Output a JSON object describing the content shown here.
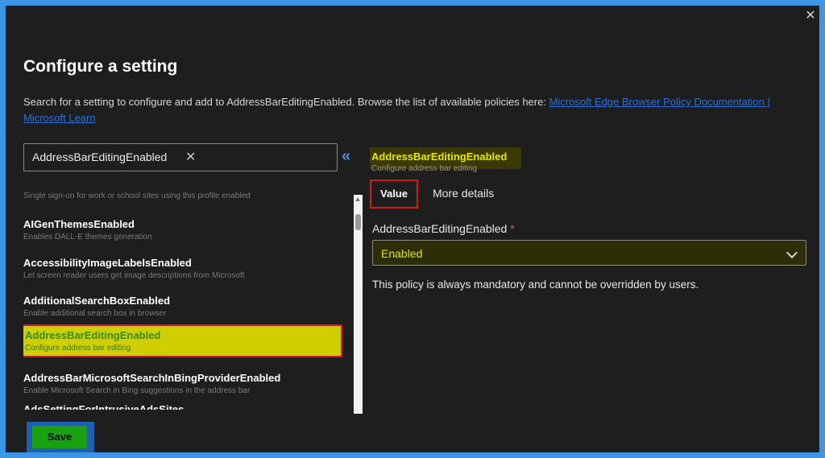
{
  "dialog": {
    "title": "Configure a setting",
    "description_text": "Search for a setting to configure and add to AddressBarEditingEnabled. Browse the list of available policies here: ",
    "description_link": "Microsoft Edge Browser Policy Documentation | Microsoft Learn",
    "close_glyph": "✕"
  },
  "search": {
    "value": "AddressBarEditingEnabled",
    "clear_glyph": "✕",
    "collapse_glyph": "«"
  },
  "list": {
    "items": [
      {
        "name": "",
        "desc": "Single sign-on for work or school sites using this profile enabled"
      },
      {
        "name": "AIGenThemesEnabled",
        "desc": "Enables DALL-E themes generation"
      },
      {
        "name": "AccessibilityImageLabelsEnabled",
        "desc": "Let screen reader users get image descriptions from Microsoft"
      },
      {
        "name": "AdditionalSearchBoxEnabled",
        "desc": "Enable additional search box in browser"
      },
      {
        "name": "AddressBarEditingEnabled",
        "desc": "Configure address bar editing"
      },
      {
        "name": "AddressBarMicrosoftSearchInBingProviderEnabled",
        "desc": "Enable Microsoft Search in Bing suggestions in the address bar"
      },
      {
        "name": "AdsSettingForIntrusiveAdsSites",
        "desc": ""
      }
    ]
  },
  "detail": {
    "name": "AddressBarEditingEnabled",
    "subtitle": "Configure address bar editing",
    "tabs": [
      "Value",
      "More details"
    ],
    "field_label": "AddressBarEditingEnabled",
    "required_mark": "*",
    "selected_value": "Enabled",
    "note": "This policy is always mandatory and cannot be overridden by users."
  },
  "footer": {
    "save_label": "Save"
  }
}
